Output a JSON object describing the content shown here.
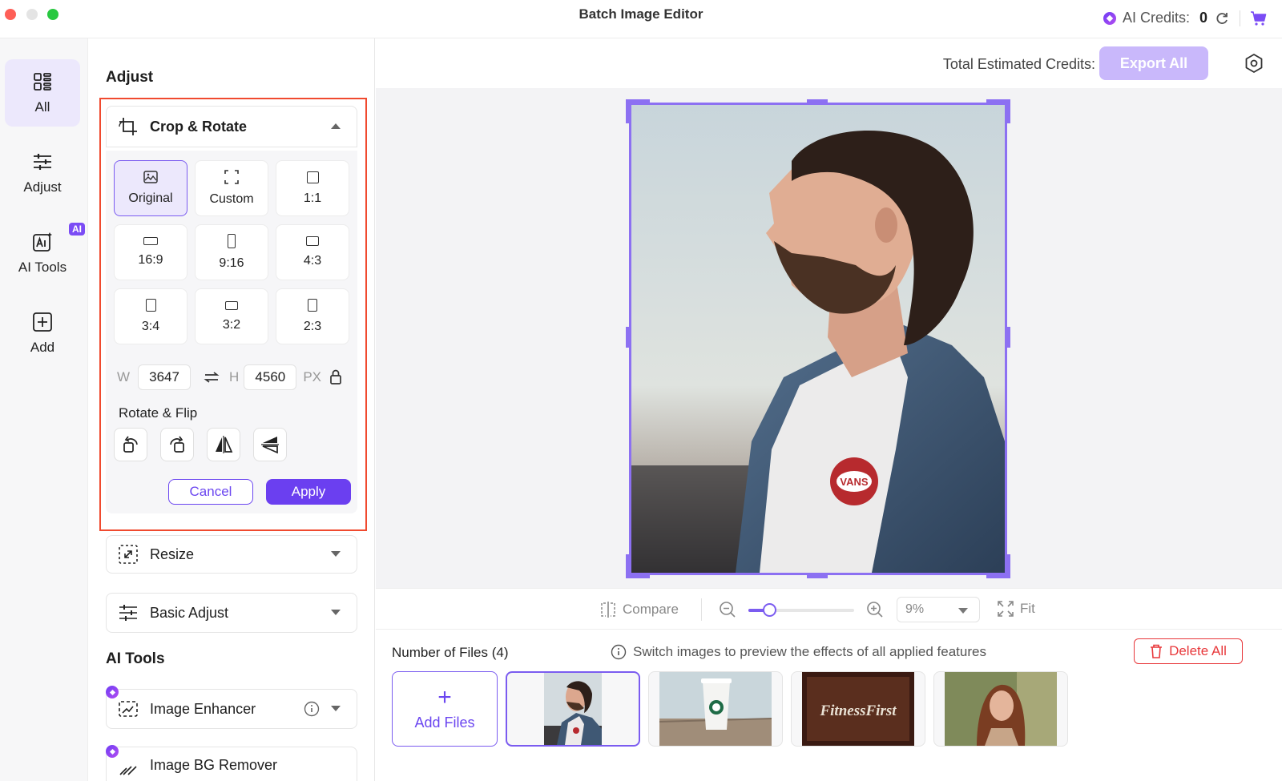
{
  "app": {
    "title": "Batch Image Editor"
  },
  "credits": {
    "label": "AI Credits:",
    "value": "0"
  },
  "rail": {
    "items": [
      {
        "label": "All"
      },
      {
        "label": "Adjust"
      },
      {
        "label": "AI Tools",
        "badge": "AI"
      },
      {
        "label": "Add"
      }
    ]
  },
  "panel": {
    "adjust_title": "Adjust",
    "crop": {
      "title": "Crop & Rotate",
      "ratios": [
        "Original",
        "Custom",
        "1:1",
        "16:9",
        "9:16",
        "4:3",
        "3:4",
        "3:2",
        "2:3"
      ],
      "selected": "Original",
      "w_label": "W",
      "width": "3647",
      "h_label": "H",
      "height": "4560",
      "unit": "PX",
      "rotate_flip_title": "Rotate & Flip",
      "cancel": "Cancel",
      "apply": "Apply"
    },
    "resize": "Resize",
    "basic_adjust": "Basic Adjust",
    "ai_tools_title": "AI Tools",
    "image_enhancer": "Image Enhancer",
    "bg_remover": "Image BG Remover"
  },
  "main": {
    "estimated_label": "Total Estimated Credits: 0",
    "export_all": "Export All",
    "toolbar": {
      "compare": "Compare",
      "zoom": "9%",
      "fit": "Fit"
    },
    "files": {
      "count_label": "Number of Files (4)",
      "hint": "Switch images to preview the effects of all applied features",
      "delete_all": "Delete All",
      "add_files": "Add Files",
      "thumb3_text": "FitnessFirst"
    }
  },
  "colors": {
    "accent": "#6b3ff0",
    "danger": "#e8383b",
    "highlight_box": "#f04a2f"
  }
}
